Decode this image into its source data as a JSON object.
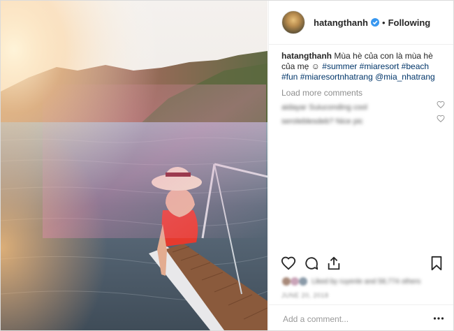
{
  "post": {
    "username": "hatangthanh",
    "separator": "•",
    "follow_label": "Following"
  },
  "caption": {
    "username": "hatangthanh",
    "text_part1": "Mùa hè của con là mùa hè của mẹ ☺",
    "tags": [
      "#summer",
      "#miaresort",
      "#beach",
      "#fun",
      "#miaresortnhatrang",
      "@mia_nhatrang"
    ]
  },
  "load_more": "Load more comments",
  "comments": [
    {
      "text": "aidayar Suiuconding cool"
    },
    {
      "text": "seroleblesdeb? Nice pic"
    }
  ],
  "likes_text": "Liked by ruyenle and 58,774 others",
  "date_text": "JUNE 20, 2018",
  "add_comment_placeholder": "Add a comment...",
  "icons": {
    "verified": "verified-badge-icon",
    "heart": "heart-icon",
    "comment": "comment-icon",
    "share": "share-icon",
    "bookmark": "bookmark-icon",
    "more": "more-options-icon"
  },
  "colors": {
    "verified_blue": "#3897f0",
    "hashtag": "#003569",
    "muted": "#8e8e8e"
  }
}
